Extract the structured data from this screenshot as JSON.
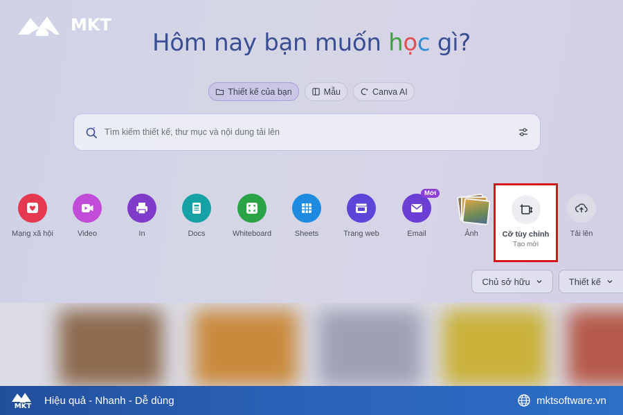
{
  "brand": {
    "logo_text": "MKT"
  },
  "headline": {
    "part1": "Hôm nay bạn muốn ",
    "h": "h",
    "o": "ọ",
    "c": "c",
    "part2": " gì?"
  },
  "tabs": [
    {
      "label": "Thiết kế của bạn",
      "icon": "folder-icon",
      "active": true
    },
    {
      "label": "Mẫu",
      "icon": "template-icon",
      "active": false
    },
    {
      "label": "Canva AI",
      "icon": "sparkle-icon",
      "active": false
    }
  ],
  "search": {
    "placeholder": "Tìm kiếm thiết kế, thư mục và nội dung tải lên"
  },
  "categories": [
    {
      "label": "Mạng xã hội",
      "color": "#e53950",
      "icon": "heart-icon"
    },
    {
      "label": "Video",
      "color": "#c04cd8",
      "icon": "video-icon"
    },
    {
      "label": "In",
      "color": "#7f3bc9",
      "icon": "printer-icon"
    },
    {
      "label": "Docs",
      "color": "#16a2a5",
      "icon": "doc-icon"
    },
    {
      "label": "Whiteboard",
      "color": "#29a345",
      "icon": "whiteboard-icon"
    },
    {
      "label": "Sheets",
      "color": "#1f8be0",
      "icon": "sheet-icon"
    },
    {
      "label": "Trang web",
      "color": "#5c45d8",
      "icon": "web-icon"
    },
    {
      "label": "Email",
      "color": "#6b3fd4",
      "icon": "mail-icon",
      "badge": "Mới"
    },
    {
      "label": "Ảnh",
      "icon": "photo-icon"
    }
  ],
  "custom": {
    "label": "Cỡ tùy chỉnh",
    "sub": "Tạo mới",
    "highlight_color": "#d7141a"
  },
  "upload": {
    "label": "Tải lên"
  },
  "filters": [
    {
      "label": "Chủ sở hữu"
    },
    {
      "label": "Thiết kế"
    }
  ],
  "footer": {
    "logo_text": "MKT",
    "slogan": "Hiệu quả - Nhanh - Dễ dùng",
    "website": "mktsoftware.vn"
  }
}
